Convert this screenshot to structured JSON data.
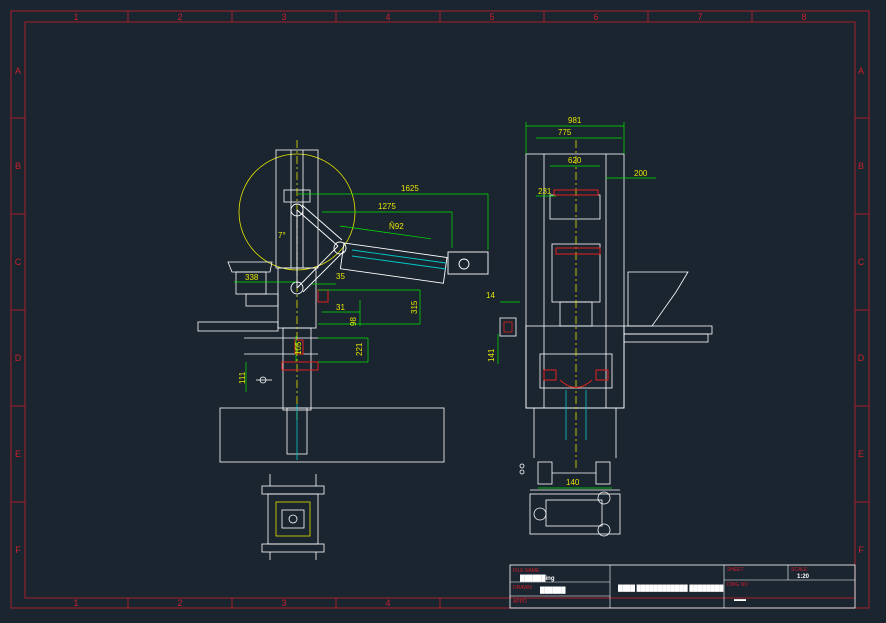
{
  "ruler": {
    "columns": [
      "1",
      "2",
      "3",
      "4",
      "5",
      "6",
      "7",
      "8"
    ],
    "rows": [
      "A",
      "B",
      "C",
      "D",
      "E",
      "F"
    ]
  },
  "side_view": {
    "dimensions": {
      "d1625": "1625",
      "d1275": "1275",
      "d892": "Ñ92",
      "d338": "338",
      "d35": "35",
      "d31": "31",
      "d98": "98",
      "d315": "315",
      "d221": "221",
      "d105": "105",
      "d111": "111",
      "angle": "7°"
    }
  },
  "front_view": {
    "dimensions": {
      "d981": "981",
      "d775": "775",
      "d620": "620",
      "d200": "200",
      "d231": "231",
      "d14": "14",
      "d141": "141",
      "d140": "140"
    }
  },
  "title_block": {
    "file_name_label": "FILE NAME",
    "file_name_value": "██████ing",
    "drawn_label": "DRAWN",
    "drawn_value": "██████",
    "appd_label": "APPD",
    "title_value": "████ ████████████ ████████",
    "sheet_label": "SHEET",
    "scale_label": "SCALE",
    "scale_value": "1:20",
    "dwg_no_label": "DWG NO",
    "dwg_no_value": "▬▬"
  },
  "colors": {
    "background": "#1b2530",
    "border": "#c8202a",
    "drawing": "#ffffff",
    "dimension": "#00e600",
    "dimension_text": "#e6e600",
    "centerline": "#e6e600",
    "hydraulic": "#00c8c8",
    "accent": "#e02020"
  }
}
